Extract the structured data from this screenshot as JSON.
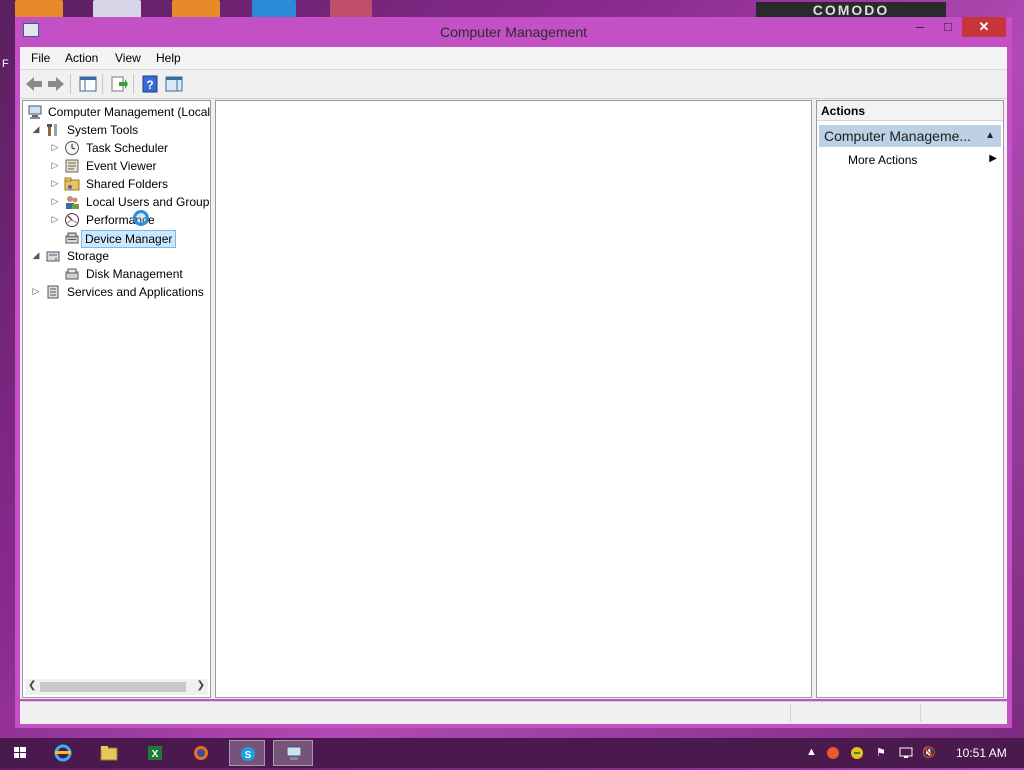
{
  "desktop": {
    "left_text": "F",
    "badge_text": "COMODO"
  },
  "window": {
    "title": "Computer Management"
  },
  "window_controls": {
    "minimize": "–",
    "maximize": "□",
    "close": "✕"
  },
  "menu": [
    "File",
    "Action",
    "View",
    "Help"
  ],
  "tree": {
    "root": "Computer Management (Local",
    "system_tools": "System Tools",
    "task_scheduler": "Task Scheduler",
    "event_viewer": "Event Viewer",
    "shared_folders": "Shared Folders",
    "local_users": "Local Users and Groups",
    "performance": "Performance",
    "device_manager": "Device Manager",
    "storage": "Storage",
    "disk_management": "Disk Management",
    "services": "Services and Applications"
  },
  "actions": {
    "header": "Actions",
    "group": "Computer Manageme...",
    "more_actions": "More Actions"
  },
  "taskbar": {
    "clock": "10:51 AM"
  },
  "colors": {
    "window_frame": "#c450c6",
    "selection": "#cce8ff",
    "close_button": "#c7353a",
    "actions_group": "#bcd0e6"
  }
}
